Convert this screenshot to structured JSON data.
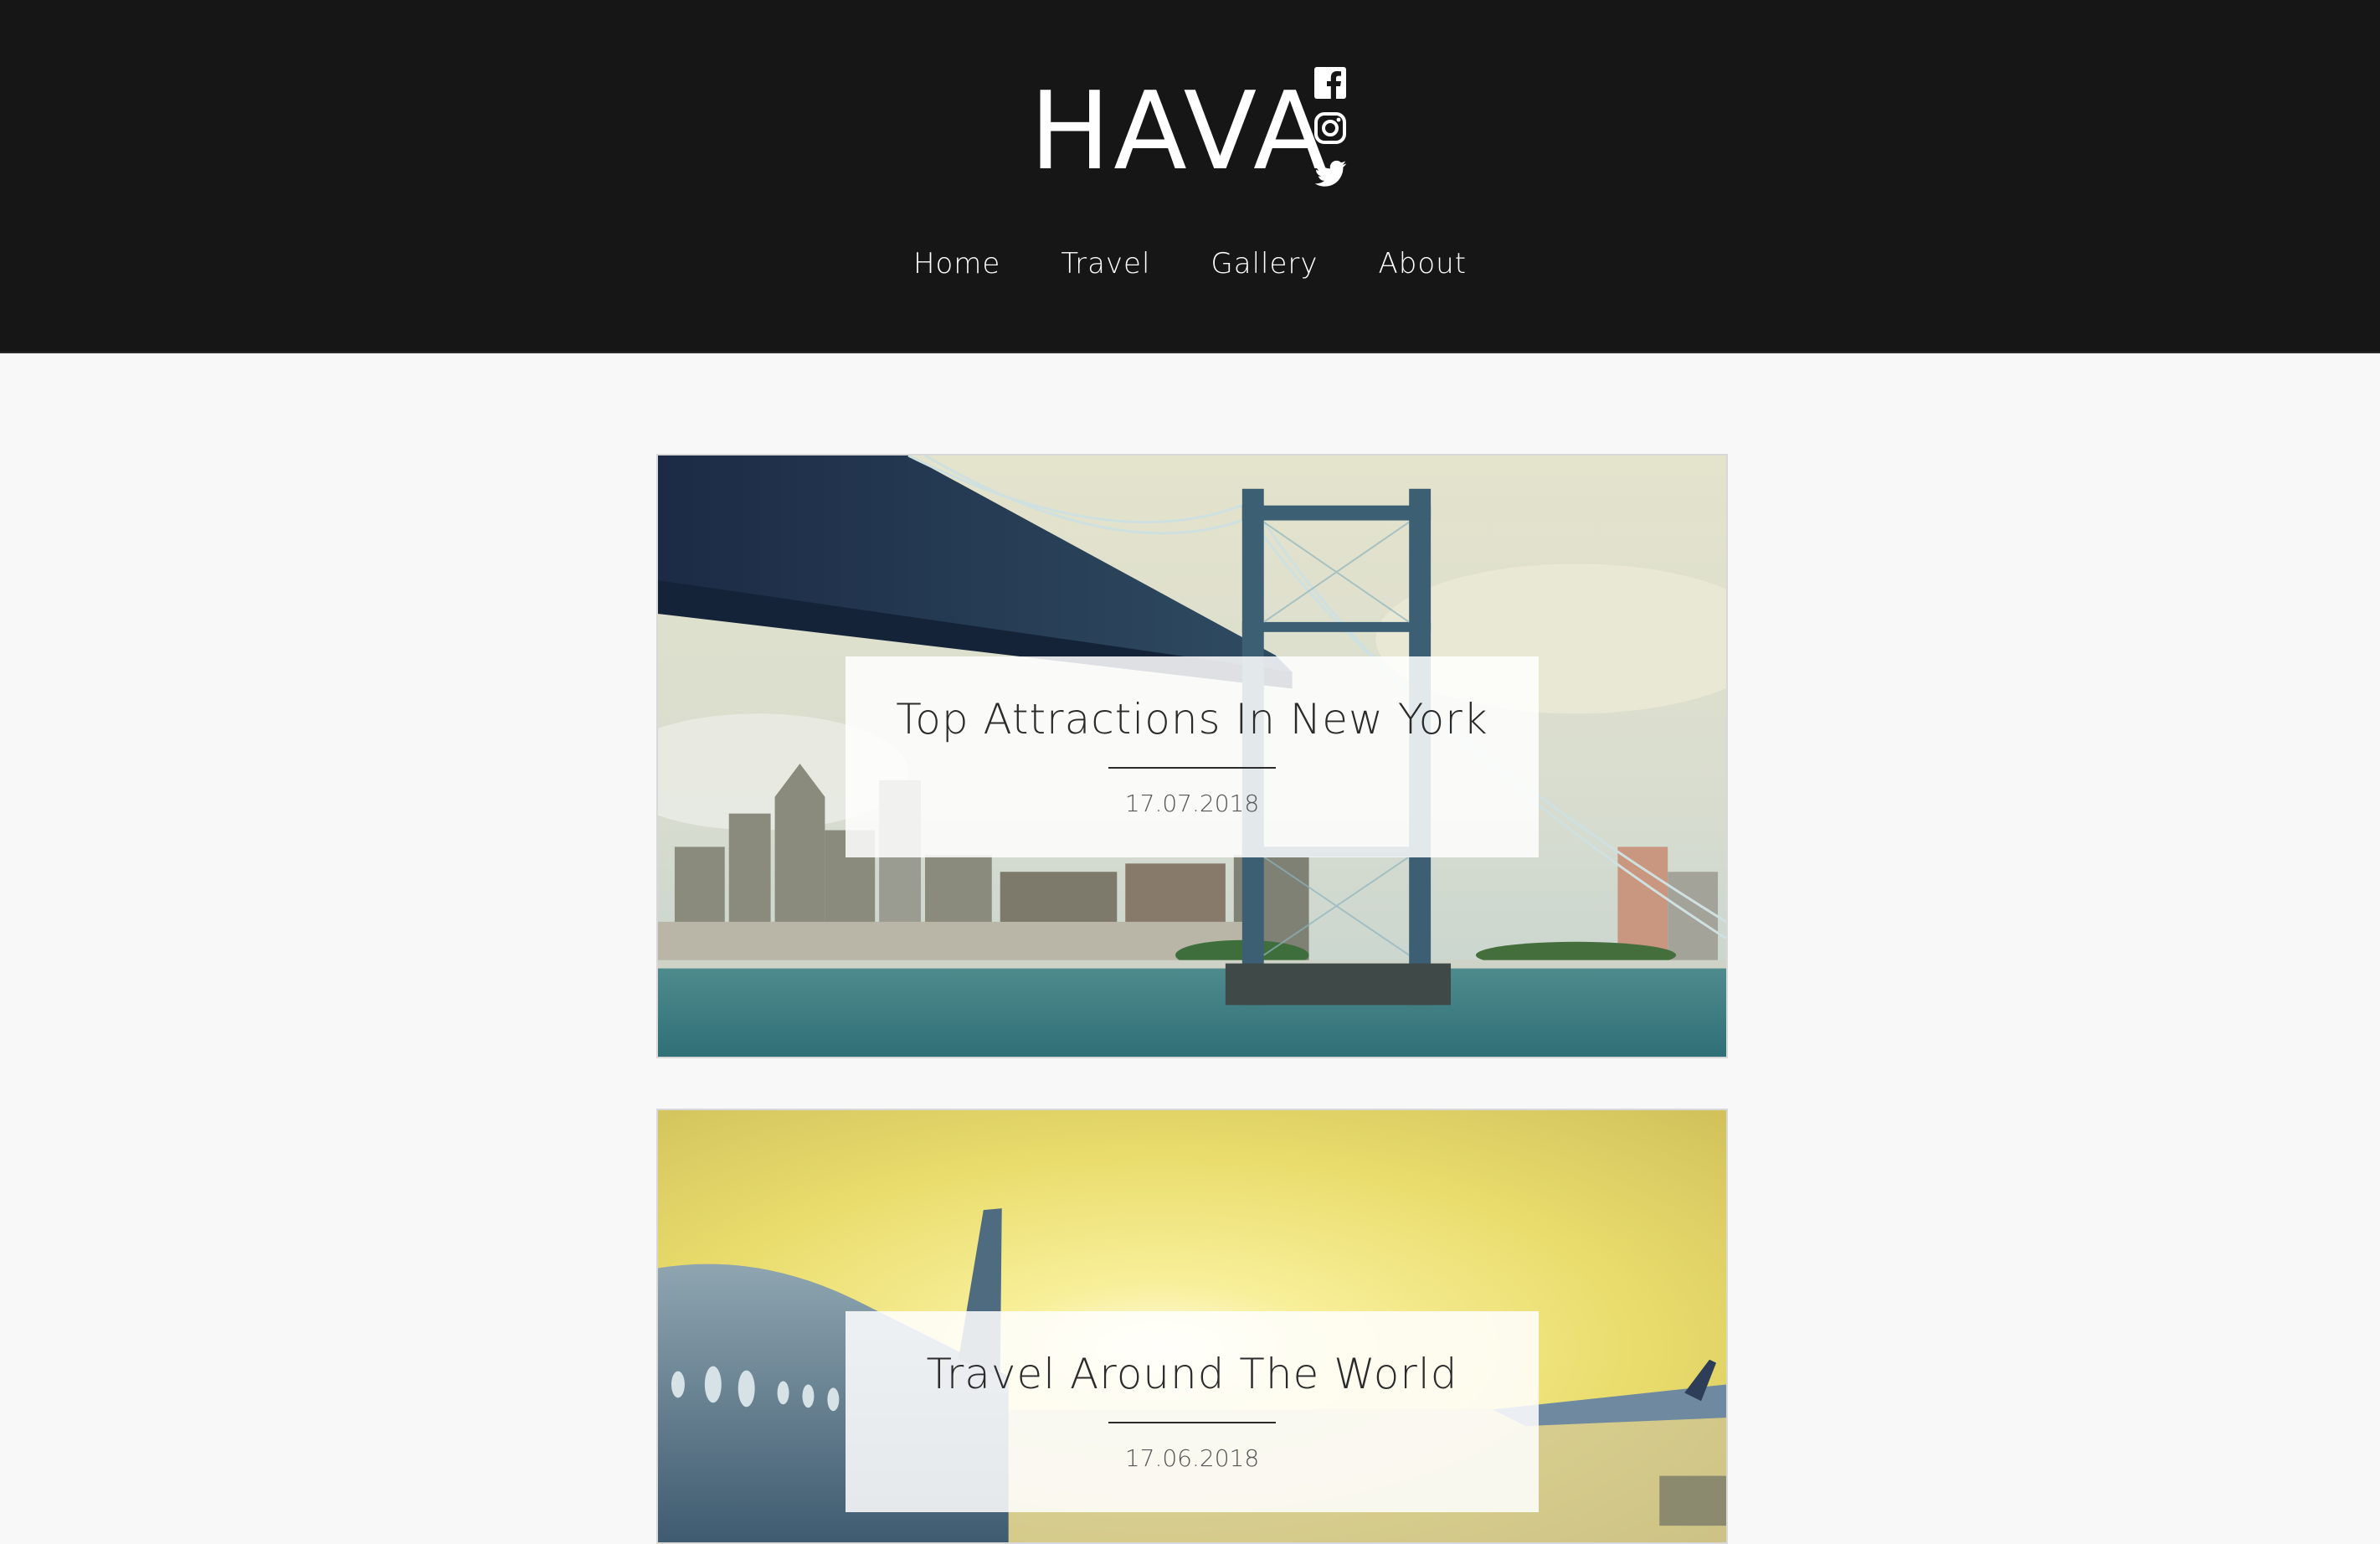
{
  "header": {
    "logo": "HAVA",
    "social": [
      {
        "name": "facebook-icon"
      },
      {
        "name": "instagram-icon"
      },
      {
        "name": "twitter-icon"
      }
    ],
    "nav": [
      {
        "label": "Home"
      },
      {
        "label": "Travel"
      },
      {
        "label": "Gallery"
      },
      {
        "label": "About"
      }
    ]
  },
  "posts": [
    {
      "title": "Top Attractions In New York",
      "date": "17.07.2018",
      "image": "manhattan-bridge-photo"
    },
    {
      "title": "Travel Around The World",
      "date": "17.06.2018",
      "image": "airplane-sunset-photo"
    }
  ],
  "colors": {
    "header_bg": "#161616",
    "page_bg": "#f8f8f8",
    "header_text": "#ffffff",
    "card_text": "#2b2b2b"
  }
}
